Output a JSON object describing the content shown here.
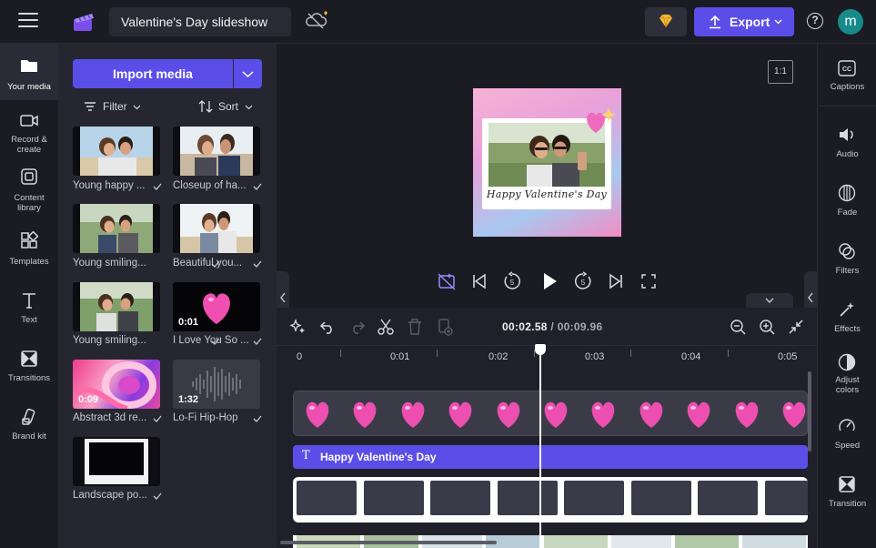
{
  "topbar": {
    "project_title": "Valentine's Day slideshow",
    "export_label": "Export",
    "avatar_initial": "m",
    "help_symbol": "?"
  },
  "left_rail": [
    {
      "label_lines": [
        "Your media"
      ],
      "icon": "folder-icon",
      "active": true
    },
    {
      "label_lines": [
        "Record &",
        "create"
      ],
      "icon": "camera-icon",
      "active": false
    },
    {
      "label_lines": [
        "Content",
        "library"
      ],
      "icon": "library-icon",
      "active": false
    },
    {
      "label_lines": [
        "Templates"
      ],
      "icon": "templates-icon",
      "active": false
    },
    {
      "label_lines": [
        "Text"
      ],
      "icon": "text-icon",
      "active": false
    },
    {
      "label_lines": [
        "Transitions"
      ],
      "icon": "transitions-icon",
      "active": false
    },
    {
      "label_lines": [
        "Brand kit"
      ],
      "icon": "brand-kit-icon",
      "active": false
    }
  ],
  "media_panel": {
    "import_label": "Import media",
    "filter_label": "Filter",
    "sort_label": "Sort",
    "items": [
      {
        "caption": "Young happy ...",
        "kind": "photo-couple-selfie",
        "duration": ""
      },
      {
        "caption": "Closeup of ha...",
        "kind": "photo-couple-beach",
        "duration": ""
      },
      {
        "caption": "Young smiling...",
        "kind": "photo-couple-selfie",
        "duration": ""
      },
      {
        "caption": "Beautiful you...",
        "kind": "photo-couple-beach",
        "duration": ""
      },
      {
        "caption": "Young smiling...",
        "kind": "photo-couple-selfie",
        "duration": ""
      },
      {
        "caption": "I Love You So ...",
        "kind": "heart-video",
        "duration": "0:01"
      },
      {
        "caption": "Abstract 3d re...",
        "kind": "abstract-video",
        "duration": "0:09"
      },
      {
        "caption": "Lo-Fi Hip-Hop",
        "kind": "audio",
        "duration": "1:32"
      },
      {
        "caption": "Landscape po...",
        "kind": "frame-image",
        "duration": ""
      }
    ]
  },
  "preview": {
    "aspect_ratio": "1:1",
    "card_text": "Happy Valentine's Day"
  },
  "timeline": {
    "current_time": "00:02.58",
    "separator": " / ",
    "total_time": "00:09.96",
    "ruler_labels": [
      "0",
      "0:01",
      "0:02",
      "0:03",
      "0:04",
      "0:05"
    ],
    "text_clip_label": "Happy Valentine's Day",
    "heart_count": 11,
    "frame_count": 8
  },
  "right_rail": [
    {
      "label_lines": [
        "Captions"
      ],
      "icon": "captions-icon"
    },
    {
      "label_lines": [
        "Audio"
      ],
      "icon": "audio-icon"
    },
    {
      "label_lines": [
        "Fade"
      ],
      "icon": "fade-icon"
    },
    {
      "label_lines": [
        "Filters"
      ],
      "icon": "filters-icon"
    },
    {
      "label_lines": [
        "Effects"
      ],
      "icon": "effects-icon"
    },
    {
      "label_lines": [
        "Adjust",
        "colors"
      ],
      "icon": "adjust-colors-icon"
    },
    {
      "label_lines": [
        "Speed"
      ],
      "icon": "speed-icon"
    },
    {
      "label_lines": [
        "Transition"
      ],
      "icon": "transition-icon"
    }
  ],
  "colors": {
    "accent": "#5b4ee8",
    "background": "#1b1b24",
    "panel": "#262631",
    "timeline": "#20202a"
  }
}
